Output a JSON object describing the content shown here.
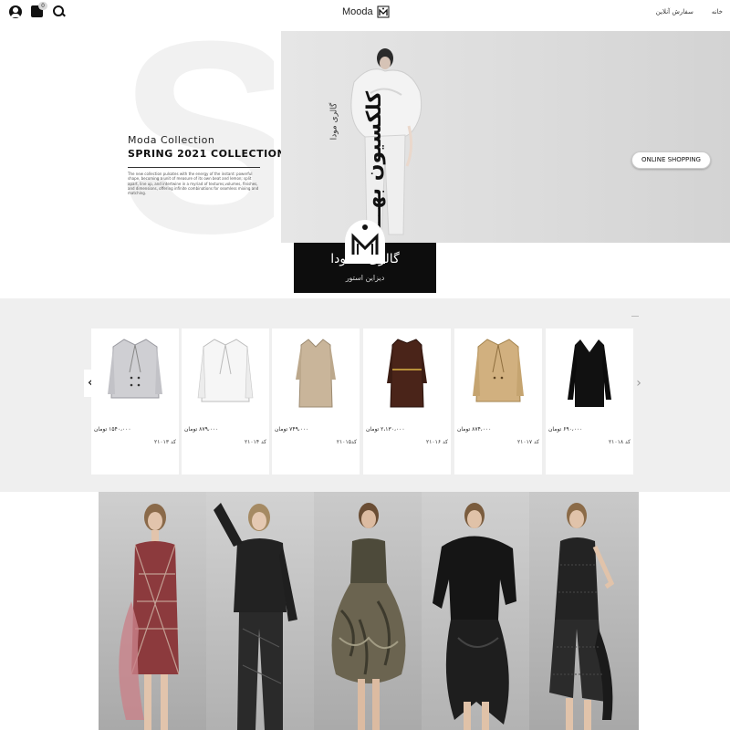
{
  "header": {
    "brand": "Mooda",
    "cart_count": "0",
    "nav": [
      "خانه",
      "سفارش آنلاین"
    ]
  },
  "hero": {
    "collection_line": "Moda Collection",
    "season_line": "SPRING 2021 COLLECTION",
    "description": "The new collection pulsates with the energy of the instant: powerful shape, becoming a unit of measure of its own beat and lemon; split apart, line up, and intertwine in a myriad of textures,volumes, finishes, and dimensions, offering infinite combinations for seamless mixing and matching.",
    "vertical_big": "کلکسیون بهـــاره",
    "vertical_small": "گالری مودا",
    "online_button": "ONLINE SHOPPING",
    "gallery_title": "گالری مـــودا",
    "gallery_subtitle": "دیزاین استور"
  },
  "products": [
    {
      "name": "grey-double-breasted-blazer",
      "price": "۱۵۴۰،۰۰۰ تومان",
      "code": "کد ۲۱۰۱۳",
      "color": "#cfcfd3"
    },
    {
      "name": "white-blazer",
      "price": "۸۷۹،۰۰۰ تومان",
      "code": "کد ۲۱۰۱۴",
      "color": "#f4f4f4"
    },
    {
      "name": "beige-shirt-dress",
      "price": "۷۴۹،۰۰۰ تومان",
      "code": "کد۲۱۰۱۵",
      "color": "#c9b59a"
    },
    {
      "name": "brown-belted-dress",
      "price": "۲،۱۳۰،۰۰۰ تومان",
      "code": "کد ۲۱۰۱۶",
      "color": "#4a2419"
    },
    {
      "name": "camel-coat",
      "price": "۸۷۴،۰۰۰ تومان",
      "code": "کد ۲۱۰۱۷",
      "color": "#d1b07f"
    },
    {
      "name": "black-v-neck-dress",
      "price": "۶۹۰،۰۰۰ تومان",
      "code": "کد ۲۱۰۱۸",
      "color": "#111111"
    }
  ],
  "gallery_panels": [
    {
      "name": "plaid-dress-look",
      "bg": "#b9b9b9",
      "garment": "#8c3a3d"
    },
    {
      "name": "black-brocade-suit-look",
      "bg": "#c2c2c2",
      "garment": "#222222"
    },
    {
      "name": "ruffled-camo-dress-look",
      "bg": "#bdbdbd",
      "garment": "#4d4a3a"
    },
    {
      "name": "black-velvet-asymmetric-look",
      "bg": "#c4c4c4",
      "garment": "#151515"
    },
    {
      "name": "dark-lace-dress-look",
      "bg": "#b8b8b8",
      "garment": "#232323"
    }
  ]
}
